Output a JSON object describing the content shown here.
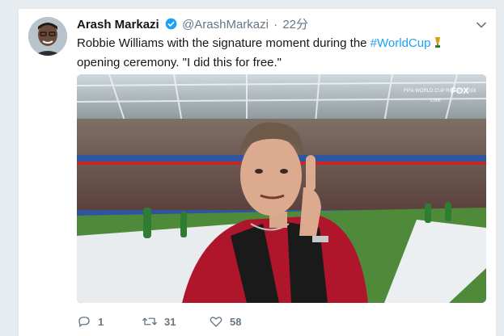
{
  "tweet": {
    "author_name": "Arash Markazi",
    "author_handle": "@ArashMarkazi",
    "separator": "·",
    "time": "22分",
    "text_part1": "Robbie Williams with the signature moment during the ",
    "hashtag": "#WorldCup",
    "text_part2": "  opening ceremony. \"I did this for free.\"",
    "media_overlay": {
      "broadcast": "FIFA WORLD CUP RUSSIA 2018",
      "network": "FOX",
      "live": "LIVE"
    }
  },
  "actions": {
    "replies": "1",
    "retweets": "31",
    "likes": "58"
  },
  "colors": {
    "accent": "#1da1f2",
    "muted": "#657786",
    "jacket": "#b0162b"
  },
  "icons": [
    "verified-badge-icon",
    "chevron-down-icon",
    "trophy-emoji-icon",
    "reply-icon",
    "retweet-icon",
    "like-icon"
  ]
}
